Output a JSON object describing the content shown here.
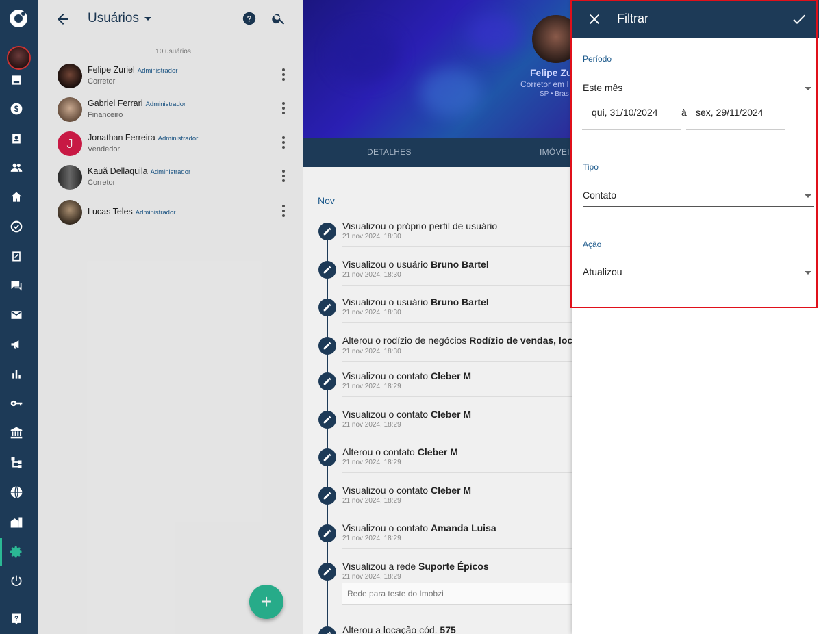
{
  "rail": {
    "icons": [
      "dashboard-icon",
      "money-icon",
      "badge-icon",
      "people-icon",
      "home-icon",
      "check-circle-icon",
      "clipboard-icon",
      "chat-icon",
      "mail-icon",
      "megaphone-icon",
      "bar-chart-icon",
      "key-icon",
      "bank-icon",
      "hierarchy-icon",
      "globe-icon",
      "buildings-icon",
      "settings-icon",
      "power-icon",
      "help-icon"
    ],
    "accent": "#2bb894"
  },
  "user_panel": {
    "title": "Usuários",
    "count": "10 usuários",
    "users": [
      {
        "name": "Felipe Zuriel",
        "role": "Administrador",
        "sub": "Corretor"
      },
      {
        "name": "Gabriel Ferrari",
        "role": "Administrador",
        "sub": "Financeiro"
      },
      {
        "name": "Jonathan Ferreira",
        "role": "Administrador",
        "sub": "Vendedor",
        "initial": "J"
      },
      {
        "name": "Kauã Dellaquila",
        "role": "Administrador",
        "sub": "Corretor"
      },
      {
        "name": "Lucas Teles",
        "role": "Administrador",
        "sub": ""
      }
    ],
    "fab_label": "+"
  },
  "profile": {
    "name": "Felipe Zu",
    "subtitle": "Corretor em I",
    "location": "SP • Bras"
  },
  "tabs": [
    "DETALHES",
    "IMÓVEIS"
  ],
  "timeline": {
    "month": "Nov",
    "items": [
      {
        "text": "Visualizou o próprio perfil de usuário",
        "bold": "",
        "date": "21 nov 2024, 18:30"
      },
      {
        "text": "Visualizou o usuário ",
        "bold": "Bruno Bartel",
        "date": "21 nov 2024, 18:30"
      },
      {
        "text": "Visualizou o usuário ",
        "bold": "Bruno Bartel",
        "date": "21 nov 2024, 18:30"
      },
      {
        "text": "Alterou o rodízio de negócios ",
        "bold": "Rodízio de vendas, locaç",
        "date": "21 nov 2024, 18:30"
      },
      {
        "text": "Visualizou o contato ",
        "bold": "Cleber M",
        "date": "21 nov 2024, 18:29"
      },
      {
        "text": "Visualizou o contato ",
        "bold": "Cleber M",
        "date": "21 nov 2024, 18:29"
      },
      {
        "text": "Alterou o contato ",
        "bold": "Cleber M",
        "date": "21 nov 2024, 18:29"
      },
      {
        "text": "Visualizou o contato ",
        "bold": "Cleber M",
        "date": "21 nov 2024, 18:29"
      },
      {
        "text": "Visualizou o contato ",
        "bold": "Amanda Luisa",
        "date": "21 nov 2024, 18:29"
      },
      {
        "text": "Visualizou a rede ",
        "bold": "Suporte Épicos",
        "date": "21 nov 2024, 18:29"
      },
      {
        "text": "Alterou a locação cód. ",
        "bold": "575",
        "date": ""
      }
    ],
    "note": "Rede para teste do Imobzi"
  },
  "filter": {
    "title": "Filtrar",
    "period_label": "Período",
    "period_value": "Este mês",
    "date_from": "qui, 31/10/2024",
    "date_sep": "à",
    "date_to": "sex, 29/11/2024",
    "type_label": "Tipo",
    "type_value": "Contato",
    "action_label": "Ação",
    "action_value": "Atualizou"
  }
}
